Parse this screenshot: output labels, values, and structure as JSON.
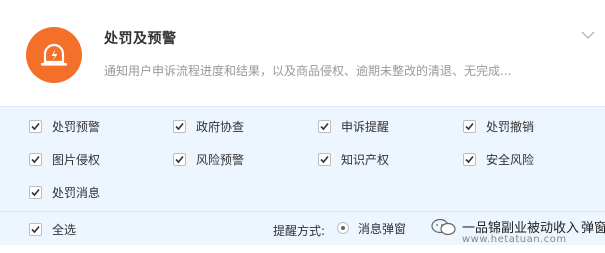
{
  "header": {
    "title": "处罚及预警",
    "description": "通知用户申诉流程进度和结果，以及商品侵权、逾期未整改的清退、无完成...",
    "brand_color": "#f36f2a",
    "logo_icon": "bell-warning-icon",
    "expand_icon": "chevron-down-icon"
  },
  "options": [
    {
      "label": "处罚预警",
      "checked": true
    },
    {
      "label": "政府协查",
      "checked": true
    },
    {
      "label": "申诉提醒",
      "checked": true
    },
    {
      "label": "处罚撤销",
      "checked": true
    },
    {
      "label": "图片侵权",
      "checked": true
    },
    {
      "label": "风险预警",
      "checked": true
    },
    {
      "label": "知识产权",
      "checked": true
    },
    {
      "label": "安全风险",
      "checked": true
    },
    {
      "label": "处罚消息",
      "checked": true
    }
  ],
  "footer": {
    "select_all_label": "全选",
    "select_all_checked": true,
    "remind_label": "提醒方式:",
    "remind_option": "消息弹窗",
    "remind_option_selected": true,
    "trailing_text": "弹窗"
  },
  "watermark": {
    "text": "一品锦副业被动收入",
    "url": "www.hetatuan.com"
  }
}
